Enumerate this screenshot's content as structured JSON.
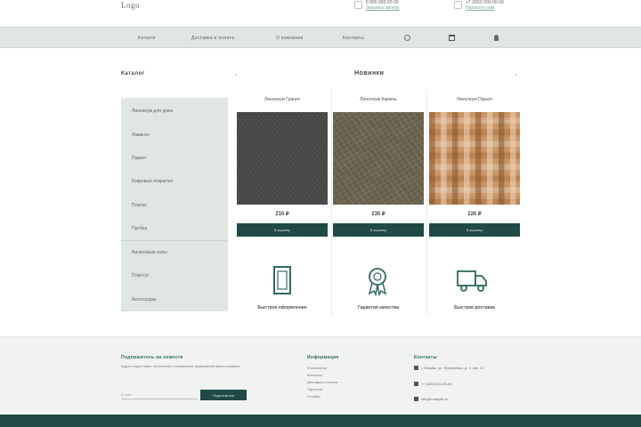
{
  "header": {
    "logo": "Logo",
    "contacts": [
      {
        "icon": "phone-icon",
        "line1": "8 800 000-00-00",
        "line2": "Заказать звонок"
      },
      {
        "icon": "mail-icon",
        "line1": "+7 (000) 000-00-00",
        "line2": "Написать нам"
      }
    ]
  },
  "nav": {
    "items": [
      "Каталог",
      "Доставка и оплата",
      "О компании",
      "Контакты"
    ],
    "icons": [
      "search-icon",
      "cart-icon",
      "user-icon"
    ]
  },
  "sidebar": {
    "title": "Каталог",
    "items": [
      "Линолеум для дома",
      "Ламинат",
      "Паркет",
      "Ковровые покрытия",
      "Плитка",
      "Пробка",
      "Виниловые полы",
      "Плинтус",
      "Аксессуары"
    ]
  },
  "main": {
    "title": "Новинки",
    "products": [
      {
        "name": "Линолеум Гранит",
        "price": "210 ₽",
        "button": "В корзину",
        "image": "dark-granite-texture"
      },
      {
        "name": "Линолеум Камень",
        "price": "230 ₽",
        "button": "В корзину",
        "image": "brown-stone-texture"
      },
      {
        "name": "Линолеум Паркет",
        "price": "220 ₽",
        "button": "В корзину",
        "image": "tile-mosaic-texture"
      }
    ],
    "features": [
      {
        "icon": "document-icon",
        "label": "Быстрое оформление"
      },
      {
        "icon": "award-icon",
        "label": "Гарантия качества"
      },
      {
        "icon": "delivery-truck-icon",
        "label": "Быстрая доставка"
      }
    ]
  },
  "footer": {
    "subscribe": {
      "title": "Подпишитесь на новости",
      "text": "Будьте в курсе новых поступлений и специальных предложений нашего магазина",
      "placeholder": "E-mail",
      "button": "Подписаться"
    },
    "info": {
      "title": "Информация",
      "links": [
        "О компании",
        "Контакты",
        "Доставка и оплата",
        "Гарантия",
        "Отзывы"
      ]
    },
    "contacts": {
      "title": "Контакты",
      "items": [
        {
          "icon": "location-icon",
          "text": "г. Москва, ул. Примерная, д. 1, оф. 10"
        },
        {
          "icon": "phone-icon",
          "text": "+7 (000) 000-00-00"
        },
        {
          "icon": "mail-icon",
          "text": "info@example.ru"
        }
      ]
    }
  },
  "colors": {
    "accent": "#1f4a45",
    "nav_bg": "#dfe6e4",
    "link": "#7ea8a0"
  }
}
